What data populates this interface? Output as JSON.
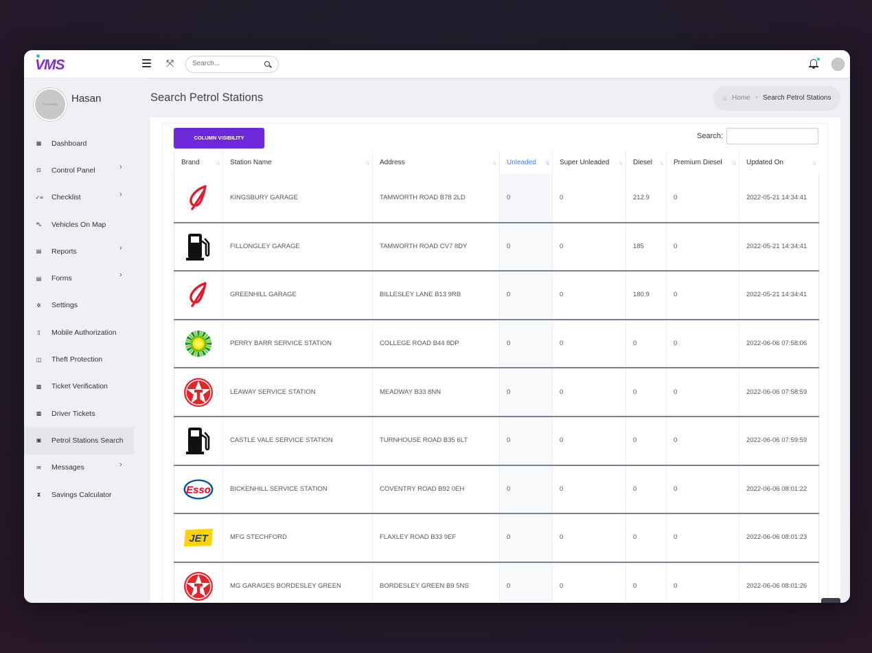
{
  "header": {
    "logo": "VMS",
    "search_placeholder": "Search..."
  },
  "profile": {
    "name": "Hasan",
    "avatar_text": "NO IMAGE"
  },
  "sidebar": {
    "items": [
      {
        "label": "Dashboard",
        "icon": "dashboard-icon",
        "caret": false
      },
      {
        "label": "Control Panel",
        "icon": "control-panel-icon",
        "caret": true
      },
      {
        "label": "Checklist",
        "icon": "checklist-icon",
        "caret": true
      },
      {
        "label": "Vehicles On Map",
        "icon": "car-icon",
        "caret": false
      },
      {
        "label": "Reports",
        "icon": "file-icon",
        "caret": true
      },
      {
        "label": "Forms",
        "icon": "file-icon",
        "caret": true
      },
      {
        "label": "Settings",
        "icon": "gear-icon",
        "caret": false
      },
      {
        "label": "Mobile Authorization",
        "icon": "mobile-icon",
        "caret": false
      },
      {
        "label": "Theft Protection",
        "icon": "shield-icon",
        "caret": false
      },
      {
        "label": "Ticket Verification",
        "icon": "ticket-icon",
        "caret": false
      },
      {
        "label": "Driver Tickets",
        "icon": "ticket-icon",
        "caret": false
      },
      {
        "label": "Petrol Stations Search",
        "icon": "fuel-icon",
        "caret": false,
        "active": true
      },
      {
        "label": "Messages",
        "icon": "envelope-icon",
        "caret": true
      },
      {
        "label": "Savings Calculator",
        "icon": "hourglass-icon",
        "caret": false
      }
    ]
  },
  "page": {
    "title": "Search Petrol Stations",
    "breadcrumb_home": "Home",
    "breadcrumb_current": "Search Petrol Stations"
  },
  "table_controls": {
    "column_visibility": "COLUMN VISIBILITY",
    "search_label": "Search:",
    "search_value": ""
  },
  "table": {
    "columns": [
      "Brand",
      "Station Name",
      "Address",
      "Unleaded",
      "Super Unleaded",
      "Diesel",
      "Premium Diesel",
      "Updated On"
    ],
    "sorted_column": "Unleaded",
    "rows": [
      {
        "brand": "Applegreen",
        "station": "KINGSBURY GARAGE",
        "address": "TAMWORTH ROAD B78 2LD",
        "unleaded": "0",
        "super": "0",
        "diesel": "212.9",
        "premium": "0",
        "updated": "2022-05-21 14:34:41"
      },
      {
        "brand": "Generic",
        "station": "FILLONGLEY GARAGE",
        "address": "TAMWORTH ROAD CV7 8DY",
        "unleaded": "0",
        "super": "0",
        "diesel": "185",
        "premium": "0",
        "updated": "2022-05-21 14:34:41"
      },
      {
        "brand": "Applegreen",
        "station": "GREENHILL GARAGE",
        "address": "BILLESLEY LANE B13 9RB",
        "unleaded": "0",
        "super": "0",
        "diesel": "180.9",
        "premium": "0",
        "updated": "2022-05-21 14:34:41"
      },
      {
        "brand": "BP",
        "station": "PERRY BARR SERVICE STATION",
        "address": "COLLEGE ROAD B44 8DP",
        "unleaded": "0",
        "super": "0",
        "diesel": "0",
        "premium": "0",
        "updated": "2022-06-06 07:58:06"
      },
      {
        "brand": "Texaco",
        "station": "LEAWAY SERVICE STATION",
        "address": "MEADWAY B33 8NN",
        "unleaded": "0",
        "super": "0",
        "diesel": "0",
        "premium": "0",
        "updated": "2022-06-06 07:58:59"
      },
      {
        "brand": "Generic",
        "station": "CASTLE VALE SERVICE STATION",
        "address": "TURNHOUSE ROAD B35 6LT",
        "unleaded": "0",
        "super": "0",
        "diesel": "0",
        "premium": "0",
        "updated": "2022-06-06 07:59:59"
      },
      {
        "brand": "Esso",
        "station": "BICKENHILL SERVICE STATION",
        "address": "COVENTRY ROAD B92 0EH",
        "unleaded": "0",
        "super": "0",
        "diesel": "0",
        "premium": "0",
        "updated": "2022-06-06 08:01:22"
      },
      {
        "brand": "Jet",
        "station": "MFG STECHFORD",
        "address": "FLAXLEY ROAD B33 9EF",
        "unleaded": "0",
        "super": "0",
        "diesel": "0",
        "premium": "0",
        "updated": "2022-06-06 08:01:23"
      },
      {
        "brand": "Texaco",
        "station": "MG GARAGES BORDESLEY GREEN",
        "address": "BORDESLEY GREEN B9 5NS",
        "unleaded": "0",
        "super": "0",
        "diesel": "0",
        "premium": "0",
        "updated": "2022-06-06 08:01:26"
      }
    ]
  },
  "colors": {
    "accent": "#6d28d9",
    "sorted_header": "#3b82f6",
    "row_divider": "#7b8093"
  }
}
